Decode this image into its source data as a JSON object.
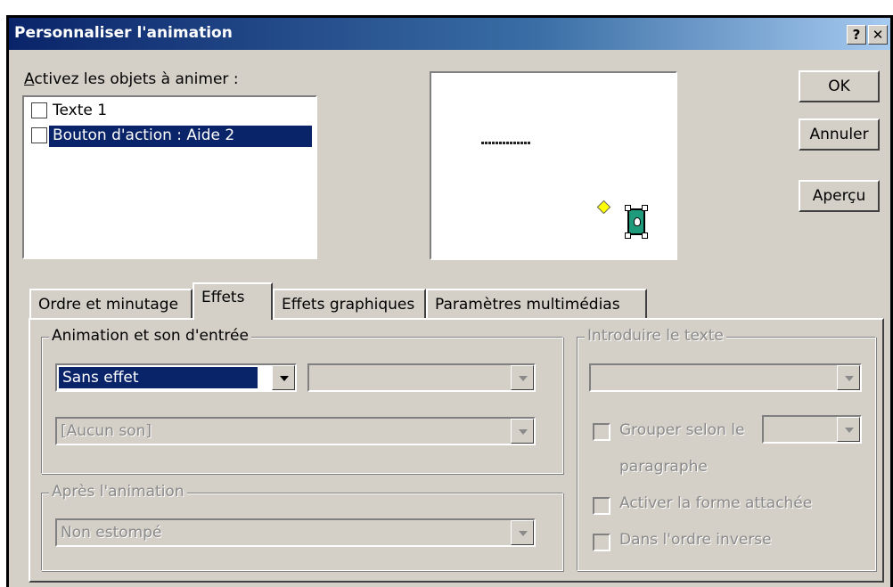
{
  "window": {
    "title": "Personnaliser l'animation",
    "help_button": "?",
    "close_button": "✕"
  },
  "objects": {
    "label": "Activez les objets à animer :",
    "items": [
      {
        "label": "Texte 1",
        "checked": false,
        "selected": false
      },
      {
        "label": "Bouton d'action : Aide 2",
        "checked": false,
        "selected": true
      }
    ]
  },
  "buttons": {
    "ok": "OK",
    "cancel": "Annuler",
    "preview": "Aperçu"
  },
  "tabs": [
    {
      "label": "Ordre et minutage",
      "active": false
    },
    {
      "label": "Effets",
      "active": true
    },
    {
      "label": "Effets graphiques",
      "active": false
    },
    {
      "label": "Paramètres multimédias",
      "active": false
    }
  ],
  "entry_group": {
    "title": "Animation et son d'entrée",
    "effect_value": "Sans effet",
    "direction_value": "",
    "sound_value": "[Aucun son]"
  },
  "after_group": {
    "title": "Après l'animation",
    "value": "Non estompé"
  },
  "text_group": {
    "title": "Introduire le texte",
    "mode_value": "",
    "group_by_label": "Grouper selon le",
    "group_by_suffix": "paragraphe",
    "group_level_value": "",
    "animate_attached_label": "Activer la forme attachée",
    "reverse_order_label": "Dans l'ordre inverse"
  },
  "colors": {
    "dialog_bg": "#d4d0c8",
    "titlebar_start": "#0a246a",
    "titlebar_end": "#a6caf0",
    "selection": "#0a246a",
    "action_button": "#1f9a7a",
    "adjust_handle": "#ffff00"
  }
}
